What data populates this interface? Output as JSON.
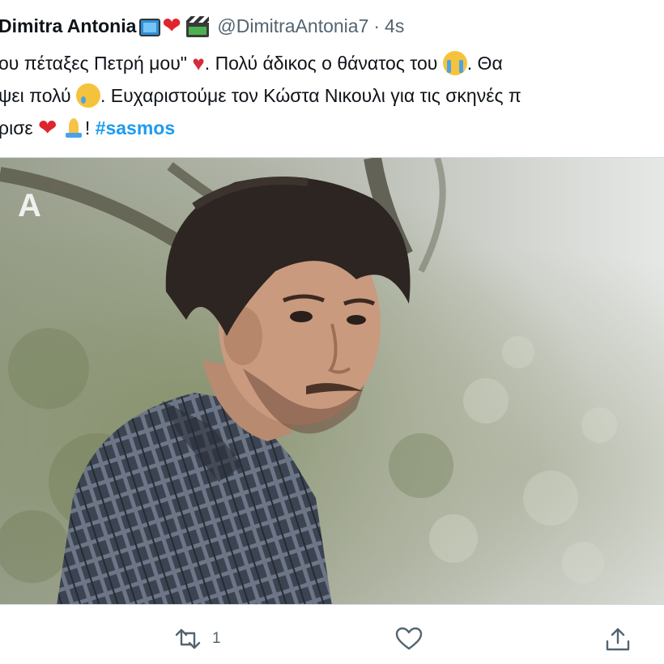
{
  "tweet": {
    "author_name": "Dimitra Antonia",
    "author_handle": "@DimitraAntonia7",
    "separator": "·",
    "time": "4s",
    "name_emojis": [
      "tv-icon",
      "red-heart-icon",
      "clapper-board-icon"
    ],
    "lines": [
      {
        "a": "ου πέταξες Πετρή μου\"",
        "b": ". Πολύ άδικος ο θάνατος του",
        "c": ". Θα"
      },
      {
        "a": "ψει πολύ",
        "b": ". Ευχαριστούμε τον Κώστα Νικουλι για τις σκηνές π"
      },
      {
        "a": "ρισε",
        "b": "!",
        "hashtag": "#sasmos"
      }
    ]
  },
  "media": {
    "channel_logo": "Α",
    "description_icon": "tv-channel-logo"
  },
  "actions": {
    "retweet_count": "1",
    "like_count": "",
    "colors": {
      "icon": "#536471",
      "hashtag": "#1d9bf0",
      "heart": "#e0242e"
    }
  }
}
